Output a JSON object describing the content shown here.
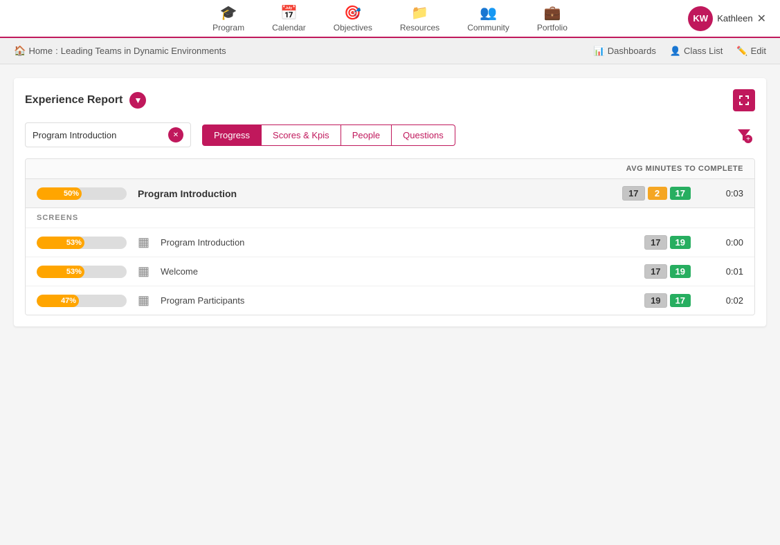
{
  "nav": {
    "items": [
      {
        "id": "program",
        "label": "Program",
        "icon": "🎓"
      },
      {
        "id": "calendar",
        "label": "Calendar",
        "icon": "📅"
      },
      {
        "id": "objectives",
        "label": "Objectives",
        "icon": "🎯"
      },
      {
        "id": "resources",
        "label": "Resources",
        "icon": "📁"
      },
      {
        "id": "community",
        "label": "Community",
        "icon": "👥"
      },
      {
        "id": "portfolio",
        "label": "Portfolio",
        "icon": "💼"
      }
    ],
    "user": {
      "initials": "KW",
      "name": "Kathleen"
    }
  },
  "breadcrumb": {
    "home_label": "Home",
    "separator": ":",
    "path": "Leading Teams in Dynamic Environments",
    "actions": [
      {
        "id": "dashboards",
        "label": "Dashboards",
        "icon": "📊"
      },
      {
        "id": "class-list",
        "label": "Class List",
        "icon": "👤"
      },
      {
        "id": "edit",
        "label": "Edit",
        "icon": "✏️"
      }
    ]
  },
  "report": {
    "title": "Experience Report",
    "filter_label": "Program Introduction",
    "tabs": [
      {
        "id": "progress",
        "label": "Progress",
        "active": true
      },
      {
        "id": "scores",
        "label": "Scores & Kpis",
        "active": false
      },
      {
        "id": "people",
        "label": "People",
        "active": false
      },
      {
        "id": "questions",
        "label": "Questions",
        "active": false
      }
    ],
    "col_header": "AVG MINUTES TO COMPLETE",
    "module": {
      "name": "Program Introduction",
      "progress": 50,
      "progress_label": "50%",
      "badges": [
        {
          "value": "17",
          "type": "gray"
        },
        {
          "value": "2",
          "type": "orange"
        },
        {
          "value": "17",
          "type": "green"
        }
      ],
      "time": "0:03"
    },
    "screens_label": "SCREENS",
    "screens": [
      {
        "name": "Program Introduction",
        "progress": 53,
        "progress_label": "53%",
        "badges": [
          {
            "value": "17",
            "type": "gray"
          },
          {
            "value": "19",
            "type": "green"
          }
        ],
        "time": "0:00"
      },
      {
        "name": "Welcome",
        "progress": 53,
        "progress_label": "53%",
        "badges": [
          {
            "value": "17",
            "type": "gray"
          },
          {
            "value": "19",
            "type": "green"
          }
        ],
        "time": "0:01"
      },
      {
        "name": "Program Participants",
        "progress": 47,
        "progress_label": "47%",
        "badges": [
          {
            "value": "19",
            "type": "gray"
          },
          {
            "value": "17",
            "type": "green"
          }
        ],
        "time": "0:02"
      }
    ]
  },
  "colors": {
    "brand": "#c0185c",
    "orange": "#f5a623",
    "green": "#27ae60",
    "gray_badge": "#aaa"
  }
}
